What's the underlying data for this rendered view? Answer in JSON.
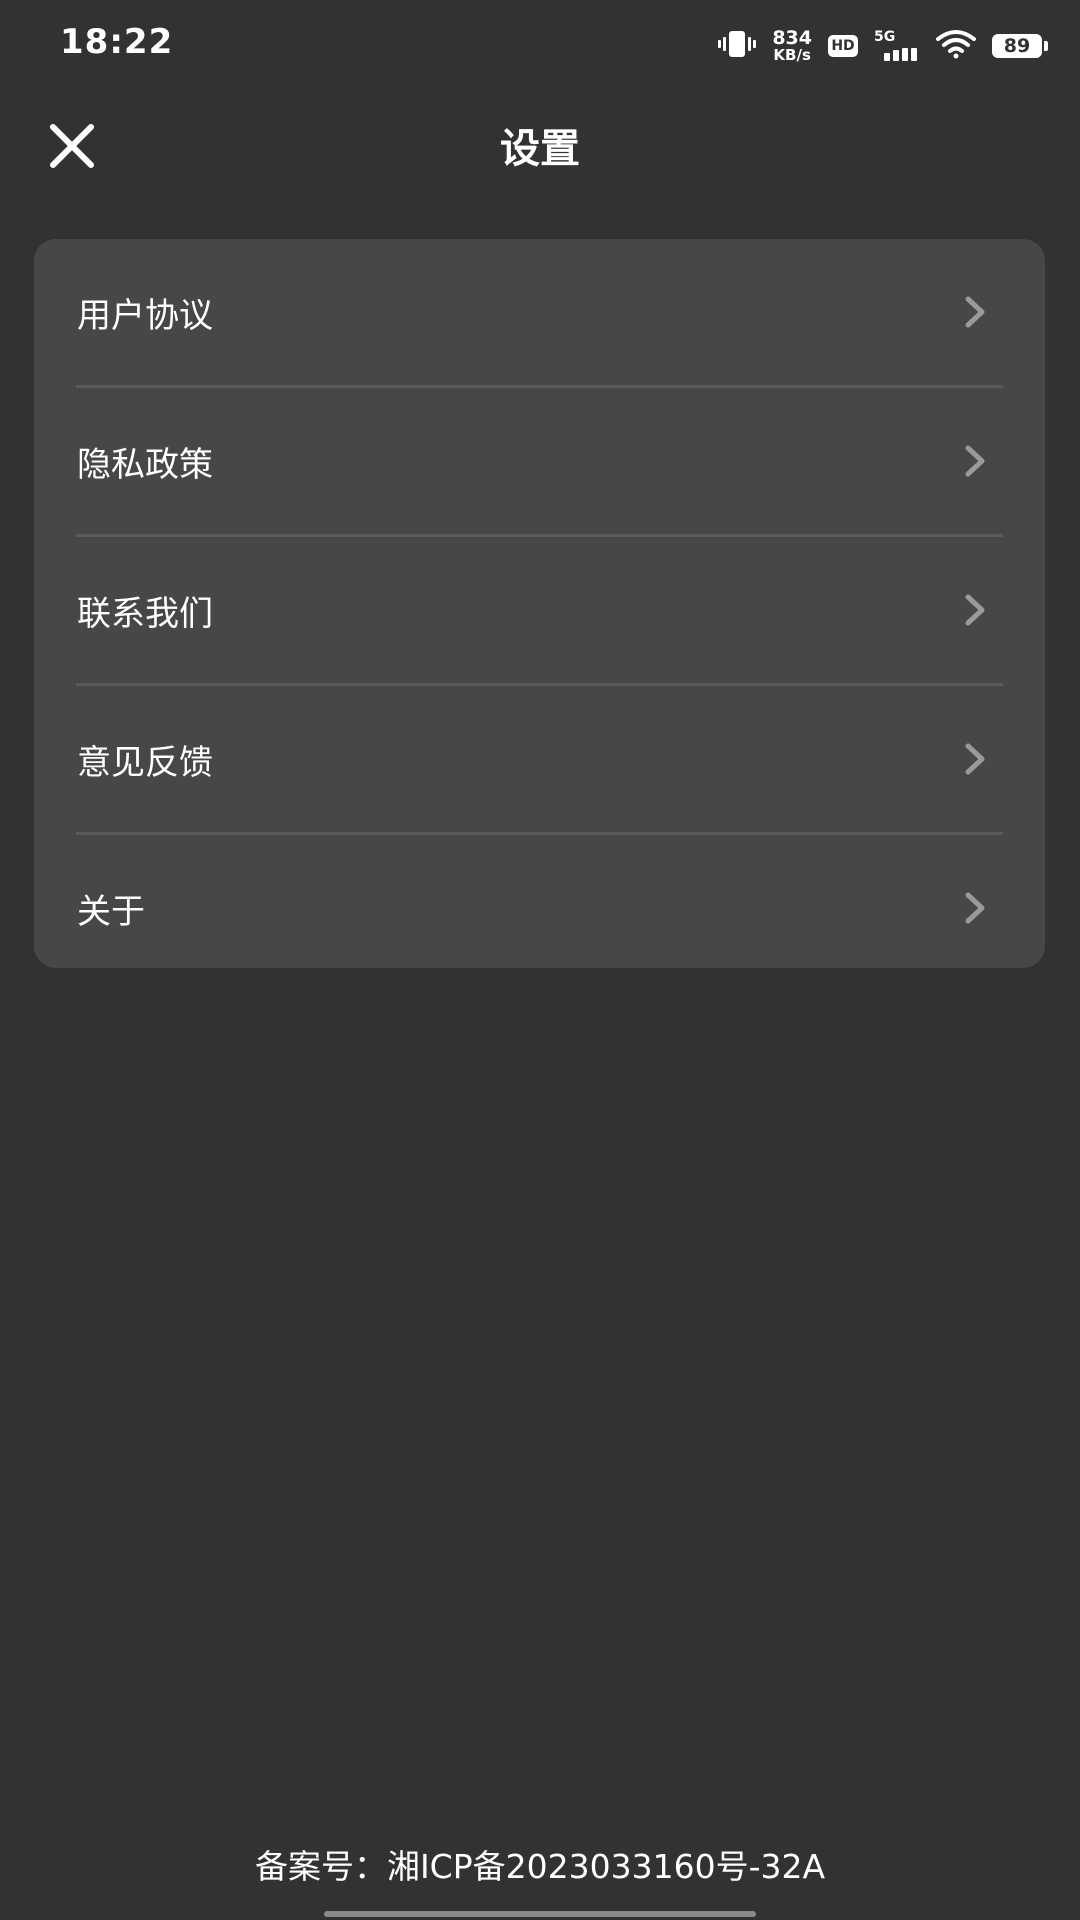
{
  "status_bar": {
    "time": "18:22",
    "net_speed_value": "834",
    "net_speed_unit": "KB/s",
    "hd_label": "HD",
    "network_type": "5G",
    "battery_level": "89"
  },
  "header": {
    "title": "设置",
    "close_icon": "close-icon"
  },
  "menu": {
    "items": [
      {
        "label": "用户协议",
        "icon": "chevron-right-icon"
      },
      {
        "label": "隐私政策",
        "icon": "chevron-right-icon"
      },
      {
        "label": "联系我们",
        "icon": "chevron-right-icon"
      },
      {
        "label": "意见反馈",
        "icon": "chevron-right-icon"
      },
      {
        "label": "关于",
        "icon": "chevron-right-icon"
      }
    ]
  },
  "footer": {
    "icp": "备案号：湘ICP备2023033160号-32A"
  },
  "colors": {
    "background": "#323232",
    "card": "#474747",
    "divider": "#5a5a5a",
    "chevron": "#9a9a9a",
    "text": "#ffffff"
  }
}
